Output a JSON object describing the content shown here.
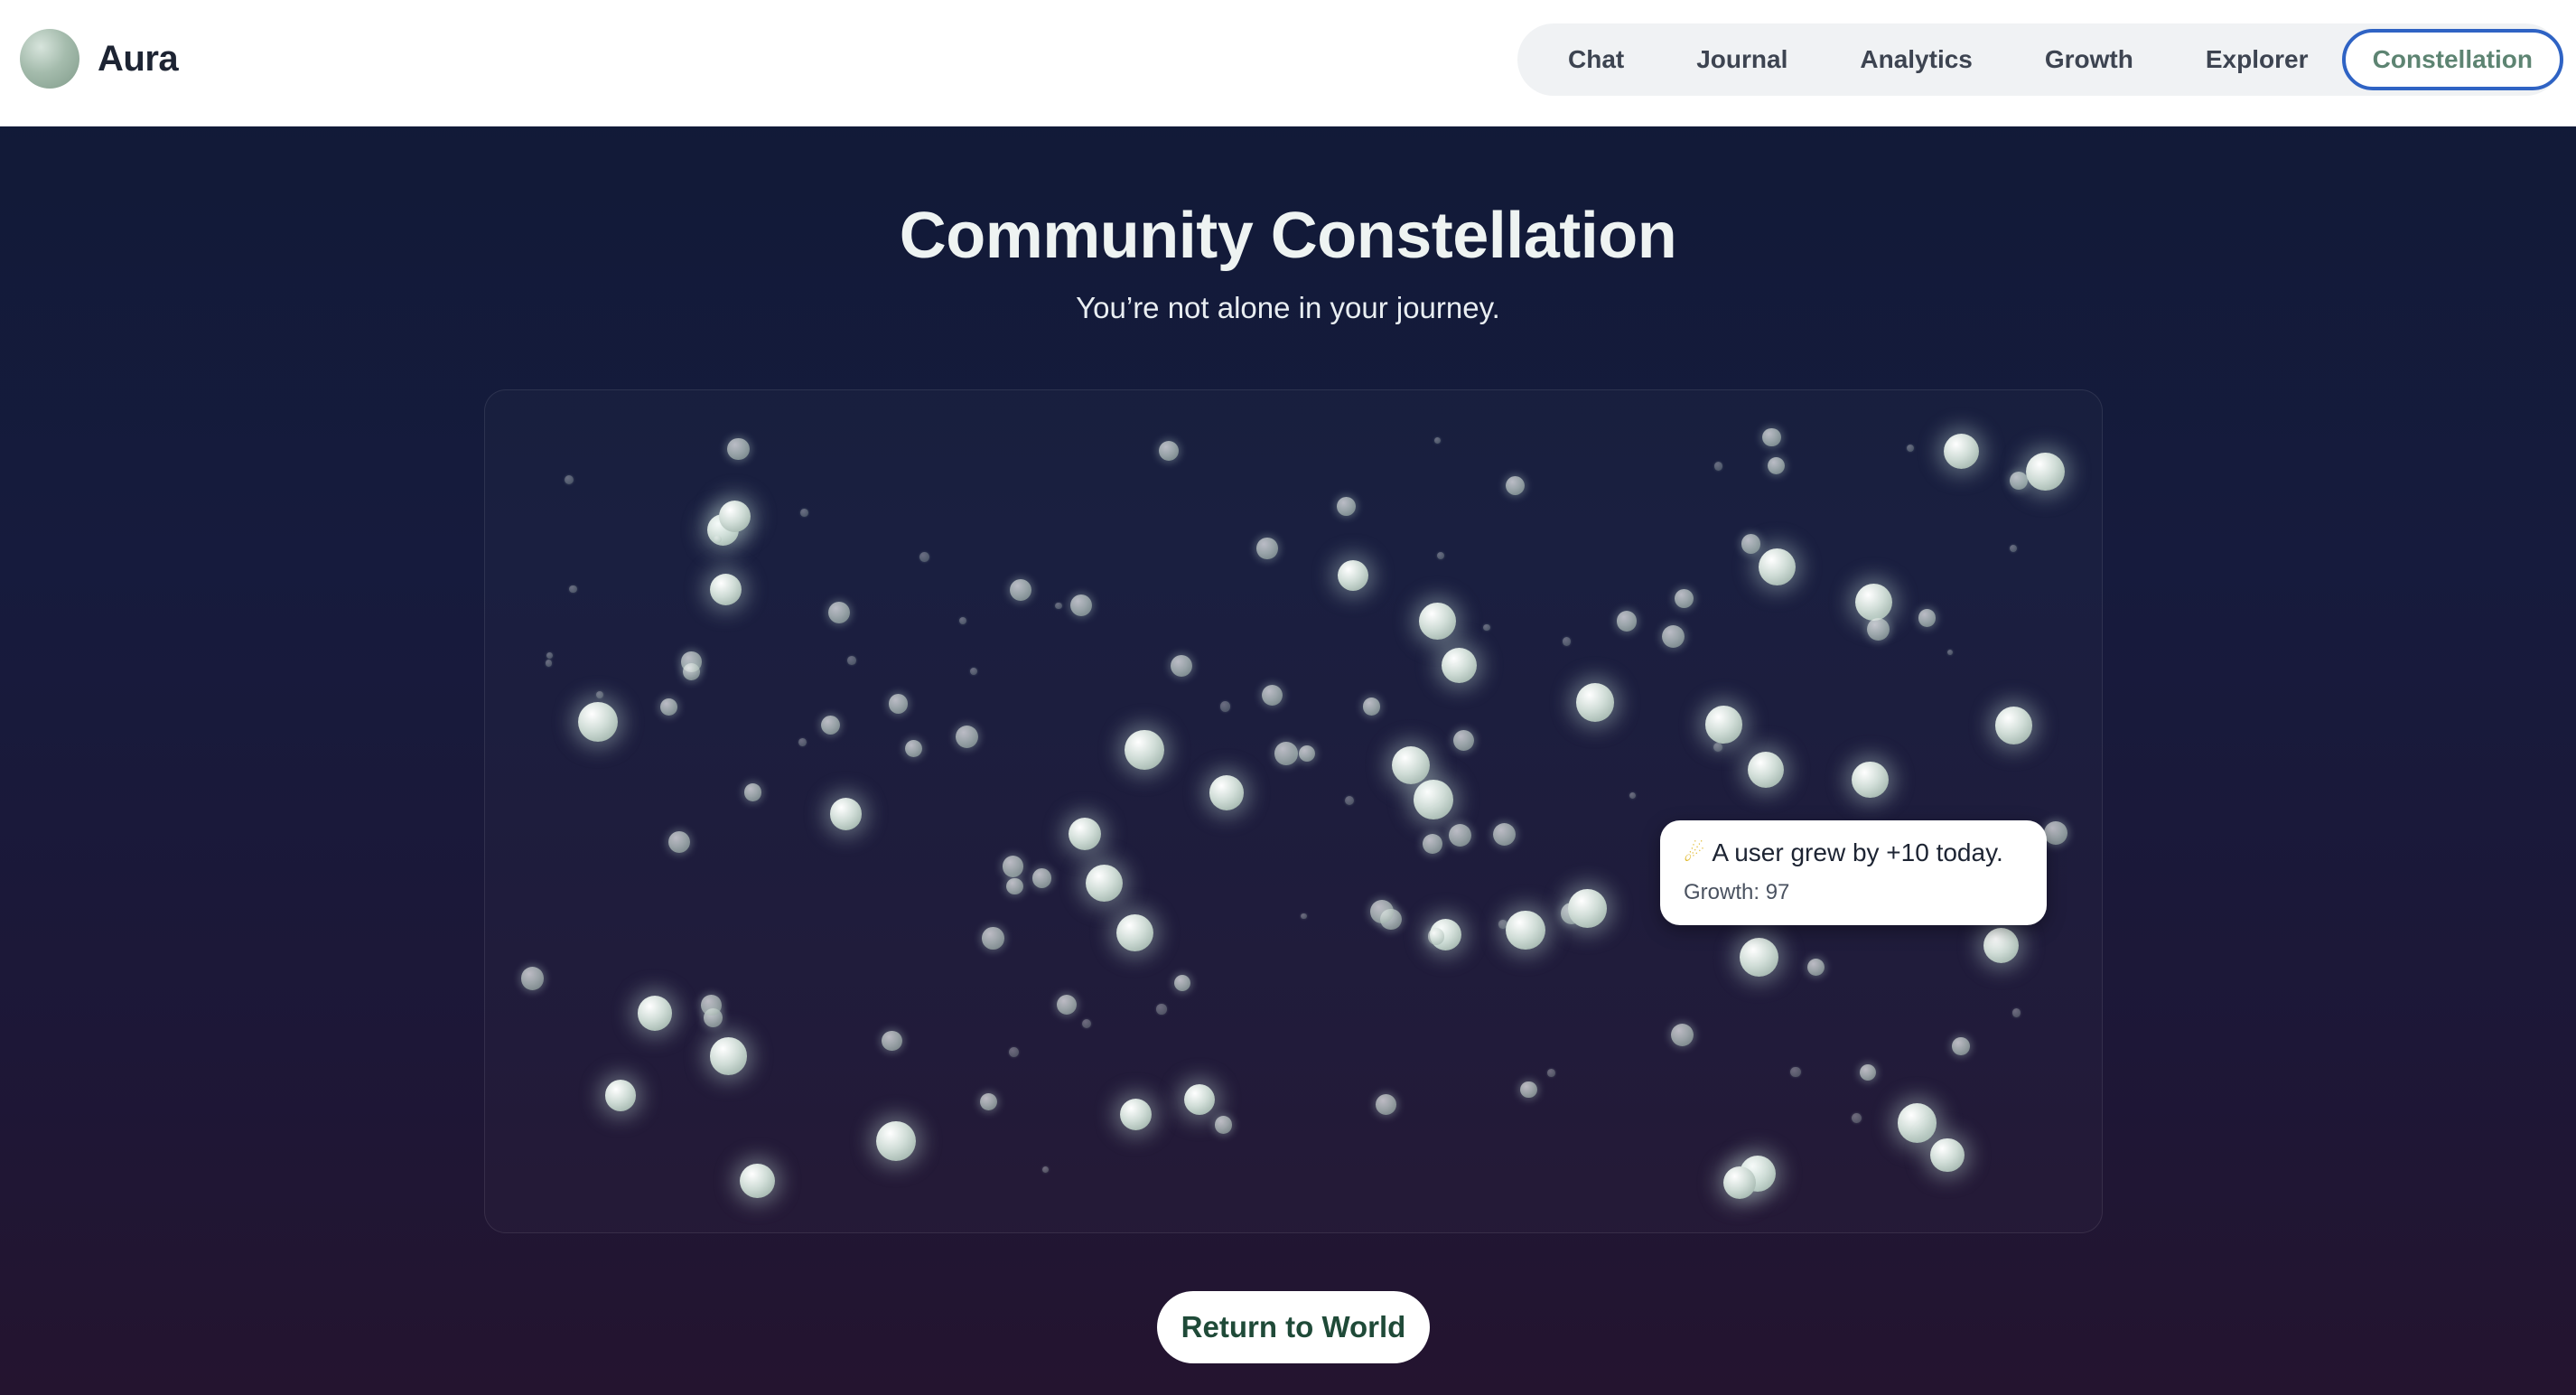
{
  "app": {
    "name": "Aura"
  },
  "nav": {
    "items": [
      {
        "label": "Chat"
      },
      {
        "label": "Journal"
      },
      {
        "label": "Analytics"
      },
      {
        "label": "Growth"
      },
      {
        "label": "Explorer"
      }
    ],
    "active": {
      "label": "Constellation"
    }
  },
  "page": {
    "title": "Community Constellation",
    "subtitle": "You’re not alone in your journey."
  },
  "constellation": {
    "star_count": 135,
    "tooltip": {
      "icon": "shooting-star-icon",
      "message": "A user grew by +10 today.",
      "detail": "Growth: 97"
    }
  },
  "actions": {
    "return_label": "Return to World"
  },
  "colors": {
    "brand_accent": "#5d8472",
    "active_border": "#2f63c4",
    "background_top": "#101a36",
    "background_bottom": "#24142f"
  }
}
